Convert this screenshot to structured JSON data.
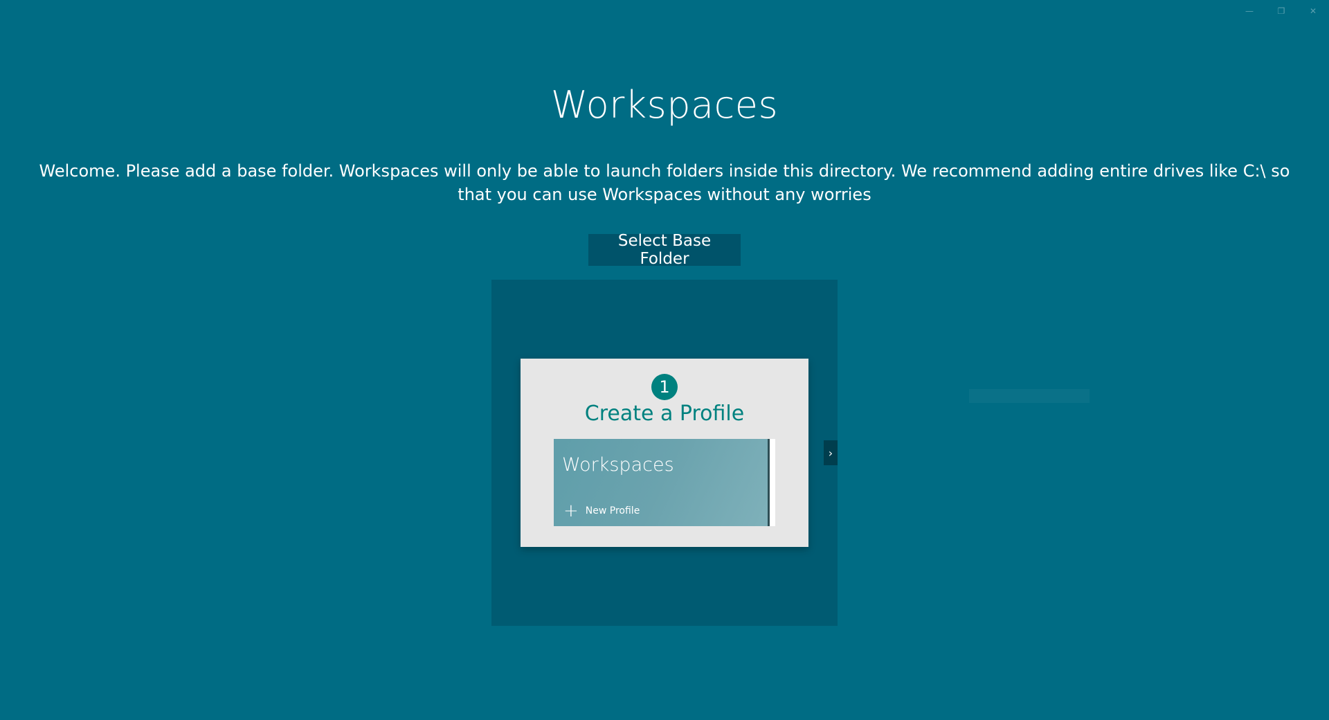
{
  "window": {
    "minimize_glyph": "—",
    "maximize_glyph": "❐",
    "close_glyph": "✕"
  },
  "page": {
    "title": "Workspaces",
    "welcome_text": "Welcome. Please add a base folder. Workspaces will only be able to launch folders inside this directory. We recommend adding entire drives like C:\\ so that you can use Workspaces without any worries",
    "select_button_label": "Select Base Folder"
  },
  "flipview": {
    "step_number": "1",
    "card_title": "Create a Profile",
    "mini_app_title": "Workspaces",
    "mini_new_profile_label": "New Profile",
    "next_glyph": "›"
  },
  "colors": {
    "background": "#006C84",
    "button_bg": "#00536A",
    "flipview_bg": "#005B72",
    "accent_teal": "#00817F",
    "card_bg": "#E6E6E6"
  }
}
